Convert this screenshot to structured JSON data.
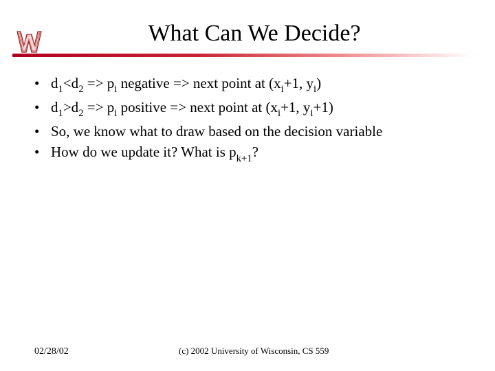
{
  "title": "What Can We Decide?",
  "logo": {
    "letter": "W",
    "name": "wisconsin-w-logo"
  },
  "bullets": [
    {
      "parts": [
        {
          "t": "d",
          "sub": false
        },
        {
          "t": "1",
          "sub": true
        },
        {
          "t": "<d",
          "sub": false
        },
        {
          "t": "2",
          "sub": true
        },
        {
          "t": " => p",
          "sub": false
        },
        {
          "t": "i",
          "sub": true
        },
        {
          "t": " negative => next point at (x",
          "sub": false
        },
        {
          "t": "i",
          "sub": true
        },
        {
          "t": "+1, y",
          "sub": false
        },
        {
          "t": "i",
          "sub": true
        },
        {
          "t": ")",
          "sub": false
        }
      ]
    },
    {
      "parts": [
        {
          "t": "d",
          "sub": false
        },
        {
          "t": "1",
          "sub": true
        },
        {
          "t": ">d",
          "sub": false
        },
        {
          "t": "2",
          "sub": true
        },
        {
          "t": " => p",
          "sub": false
        },
        {
          "t": "i",
          "sub": true
        },
        {
          "t": " positive => next point at  (x",
          "sub": false
        },
        {
          "t": "i",
          "sub": true
        },
        {
          "t": "+1, y",
          "sub": false
        },
        {
          "t": "i",
          "sub": true
        },
        {
          "t": "+1)",
          "sub": false
        }
      ]
    },
    {
      "parts": [
        {
          "t": "So, we know what to draw based on the decision variable",
          "sub": false
        }
      ]
    },
    {
      "parts": [
        {
          "t": "How do we update it? What is p",
          "sub": false
        },
        {
          "t": "k+1",
          "sub": true
        },
        {
          "t": "?",
          "sub": false
        }
      ]
    }
  ],
  "footer": {
    "date": "02/28/02",
    "copyright": "(c) 2002 University of Wisconsin, CS 559"
  }
}
